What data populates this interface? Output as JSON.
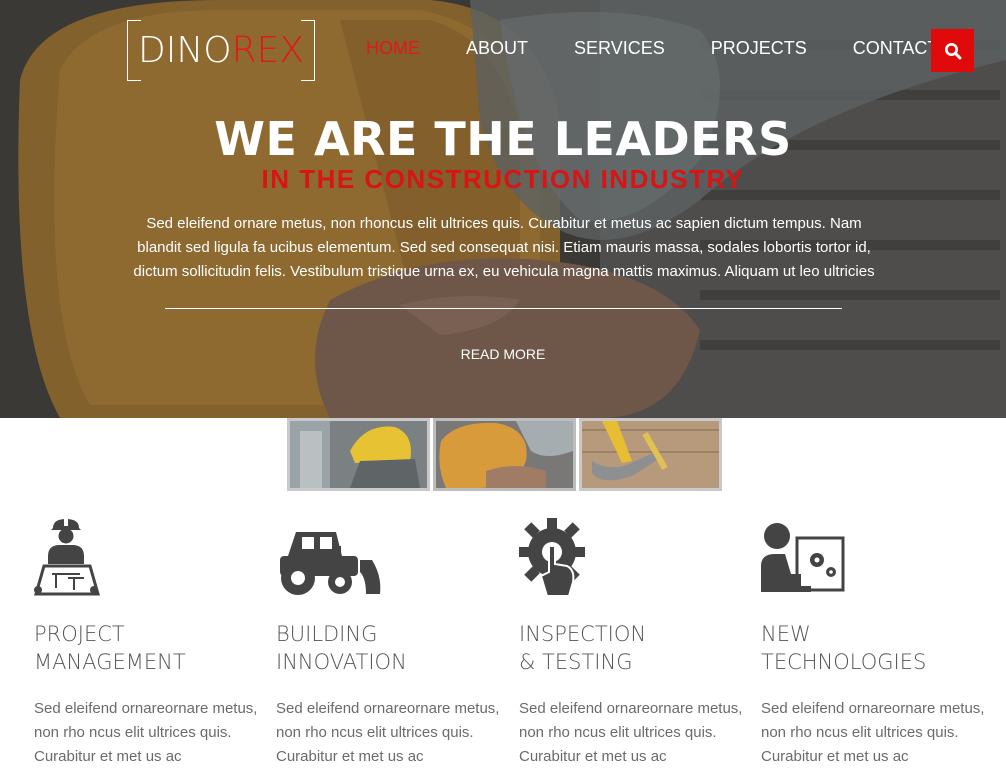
{
  "brand": {
    "part1": "DINO",
    "part2": "REX"
  },
  "nav": {
    "items": [
      {
        "label": "HOME",
        "active": true
      },
      {
        "label": "ABOUT",
        "active": false
      },
      {
        "label": "SERVICES",
        "active": false
      },
      {
        "label": "PROJECTS",
        "active": false
      },
      {
        "label": "CONTACTS",
        "active": false
      }
    ],
    "search_icon": "search-icon"
  },
  "hero": {
    "title": "WE ARE THE LEADERS",
    "subtitle": "IN THE CONSTRUCTION INDUSTRY",
    "text": "Sed eleifend ornare metus, non rhoncus elit ultrices quis. Curabitur et metus ac sapien dictum tempus. Nam blandit sed ligula fa ucibus elementum. Sed sed consequat nisi. Etiam mauris massa, sodales lobortis tortor id, dictum sollicitudin felis. Vestibulum tristique urna ex, eu vehicula magna mattis maximus. Aliquam ut leo ultricies",
    "read_more": "READ MORE"
  },
  "features": [
    {
      "icon": "worker-blueprint-icon",
      "line1": "PROJECT",
      "line2": "MANAGEMENT",
      "text": "Sed eleifend ornareornare metus, non rho ncus elit ultrices quis. Curabitur et met us ac"
    },
    {
      "icon": "bulldozer-icon",
      "line1": "BUILDING",
      "line2": "INNOVATION",
      "text": "Sed eleifend ornareornare metus, non rho ncus elit ultrices quis. Curabitur et met us ac"
    },
    {
      "icon": "gear-hand-icon",
      "line1": "INSPECTION",
      "line2": "& TESTING",
      "text": "Sed eleifend ornareornare metus, non rho ncus elit ultrices quis. Curabitur et met us ac"
    },
    {
      "icon": "engineer-computer-icon",
      "line1": "NEW",
      "line2": "TECHNOLOGIES",
      "text": "Sed eleifend ornareornare metus, non rho ncus elit ultrices quis. Curabitur et met us ac"
    }
  ],
  "colors": {
    "accent": "#e00a0a",
    "text": "#6b6b6b",
    "heading": "#555555"
  }
}
